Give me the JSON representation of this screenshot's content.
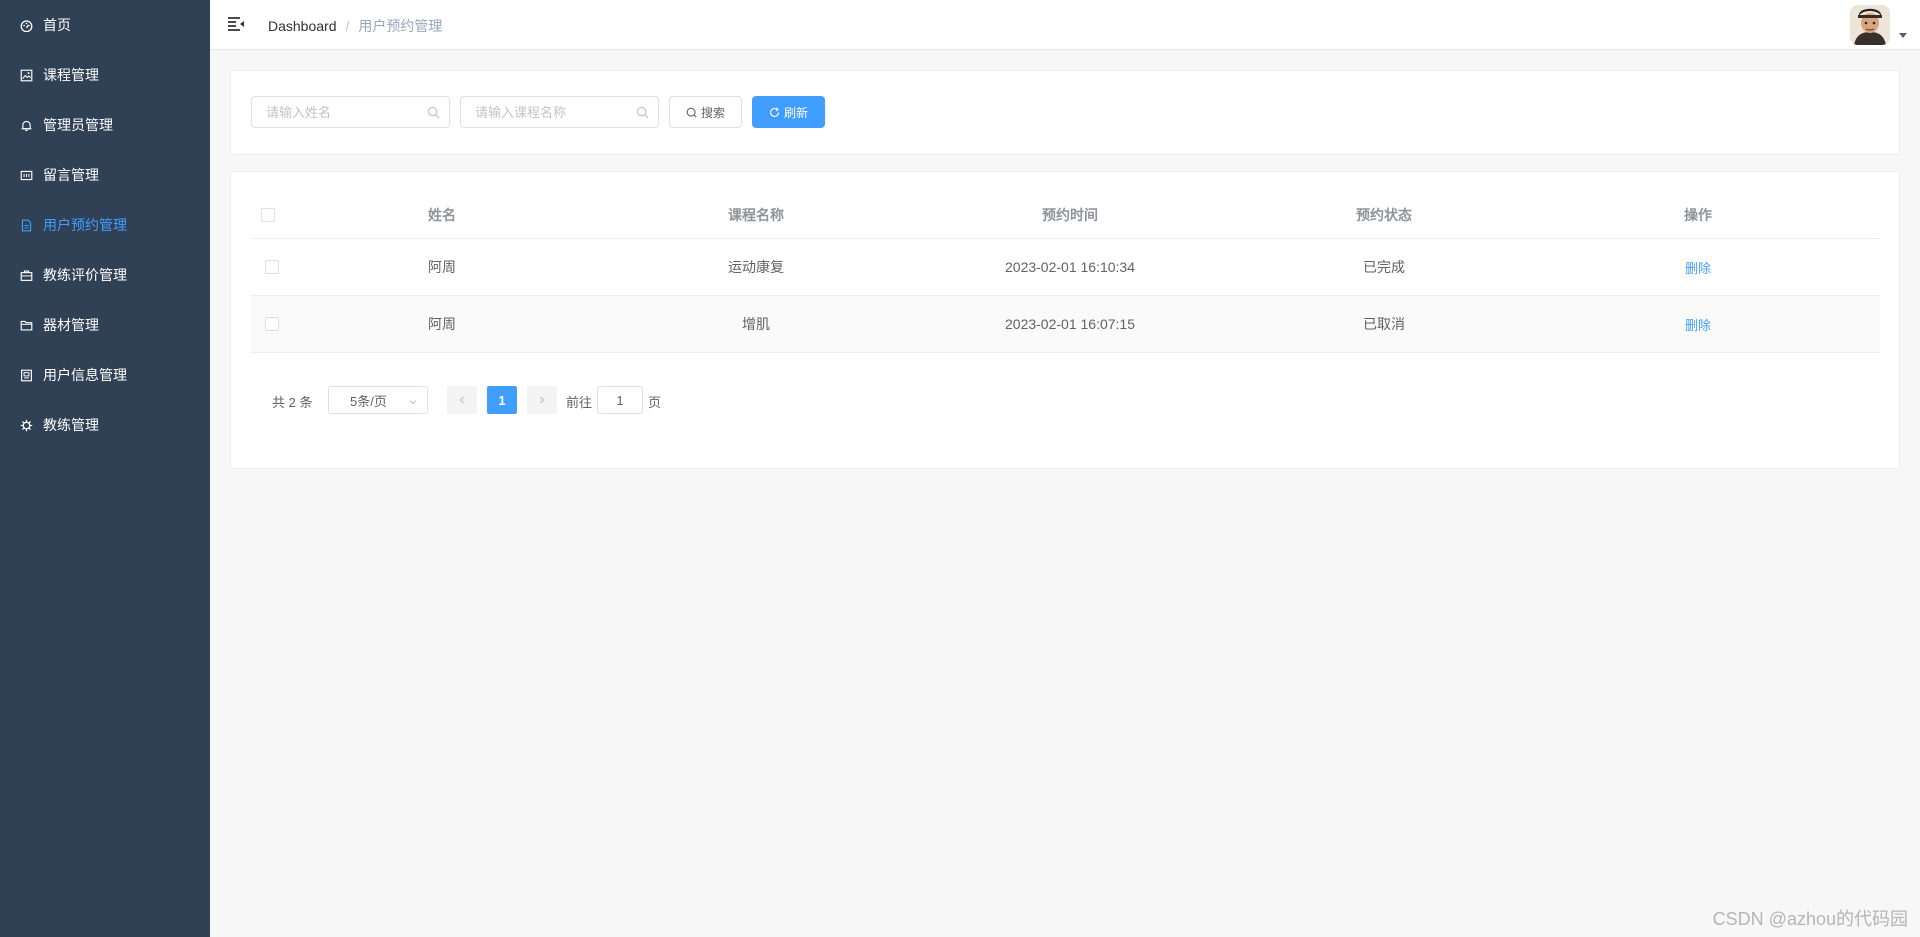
{
  "sidebar": {
    "items": [
      {
        "label": "首页",
        "icon": "dashboard-icon"
      },
      {
        "label": "课程管理",
        "icon": "picture-icon"
      },
      {
        "label": "管理员管理",
        "icon": "bell-icon"
      },
      {
        "label": "留言管理",
        "icon": "message-box-icon"
      },
      {
        "label": "用户预约管理",
        "icon": "document-icon",
        "active": true
      },
      {
        "label": "教练评价管理",
        "icon": "briefcase-icon"
      },
      {
        "label": "器材管理",
        "icon": "folder-icon"
      },
      {
        "label": "用户信息管理",
        "icon": "notebook-icon"
      },
      {
        "label": "教练管理",
        "icon": "setting-icon"
      }
    ]
  },
  "header": {
    "breadcrumb_root": "Dashboard",
    "breadcrumb_separator": "/",
    "breadcrumb_current": "用户预约管理"
  },
  "search": {
    "name_placeholder": "请输入姓名",
    "course_placeholder": "请输入课程名称",
    "search_label": "搜索",
    "refresh_label": "刷新"
  },
  "table": {
    "columns": [
      "姓名",
      "课程名称",
      "预约时间",
      "预约状态",
      "操作"
    ],
    "rows": [
      {
        "name": "阿周",
        "course": "运动康复",
        "time": "2023-02-01 16:10:34",
        "status": "已完成",
        "action": "删除"
      },
      {
        "name": "阿周",
        "course": "增肌",
        "time": "2023-02-01 16:07:15",
        "status": "已取消",
        "action": "删除"
      }
    ]
  },
  "pagination": {
    "total": "共 2 条",
    "page_size": "5条/页",
    "current_page": "1",
    "goto_label": "前往",
    "goto_value": "1",
    "page_label": "页"
  },
  "watermark": "CSDN @azhou的代码园",
  "colors": {
    "sidebar_bg": "#304156",
    "accent": "#409eff"
  }
}
